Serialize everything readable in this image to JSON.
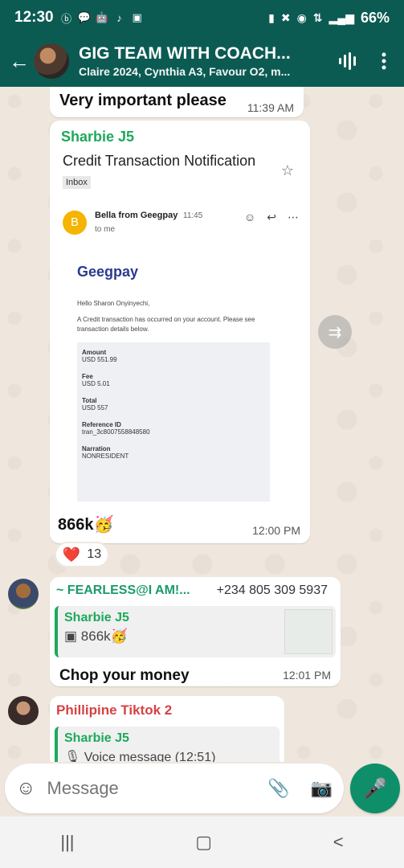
{
  "statusbar": {
    "time": "12:30",
    "battery": "66%",
    "icons": [
      "b-icon",
      "chat-icon",
      "robot-icon",
      "tiktok-icon",
      "image-icon"
    ],
    "right_icons": [
      "battery-saver-icon",
      "mute-icon",
      "hotspot-icon",
      "data-icon",
      "signal-icon"
    ]
  },
  "header": {
    "title": "GIG TEAM WITH COACH...",
    "subtitle": "Claire 2024, Cynthia A3, Favour O2, m...",
    "back_icon": "arrow-left-icon",
    "actions": [
      "audio-wave-icon",
      "more-vert-icon"
    ]
  },
  "messages": {
    "top": {
      "text": "Very important please",
      "time": "11:39 AM"
    },
    "email": {
      "sender": "Sharbie J5",
      "subject": "Credit Transaction Notification",
      "tag": "Inbox",
      "from_initial": "B",
      "from_name": "Bella from Geegpay",
      "from_time": "11:45",
      "to": "to me",
      "brand": "Geegpay",
      "greeting": "Hello Sharon Onyinyechi,",
      "intro": "A Credit transaction has occurred on your account. Please see transaction details below.",
      "details": [
        {
          "label": "Amount",
          "value": "USD 551.99"
        },
        {
          "label": "Fee",
          "value": "USD 5.01"
        },
        {
          "label": "Total",
          "value": "USD 557"
        },
        {
          "label": "Reference ID",
          "value": "tran_3c8007558848580"
        },
        {
          "label": "Narration",
          "value": "NONRESIDENT"
        }
      ],
      "caption": "866k🥳",
      "time": "12:00 PM",
      "reaction_emoji": "❤️",
      "reaction_count": "13"
    },
    "fearless": {
      "name": "~ FEARLESS@I AM!...",
      "phone": "+234 805 309 5937",
      "quote_name": "Sharbie J5",
      "quote_text": "866k🥳",
      "body": "Chop your money",
      "time": "12:01 PM"
    },
    "phill": {
      "name": "Phillipine Tiktok 2",
      "quote_name": "Sharbie J5",
      "quote_text": "Voice message (12:51)"
    }
  },
  "composer": {
    "placeholder": "Message"
  },
  "colors": {
    "header": "#0b5b53",
    "accent_green": "#1ea95a",
    "mic": "#0e8f6a"
  }
}
